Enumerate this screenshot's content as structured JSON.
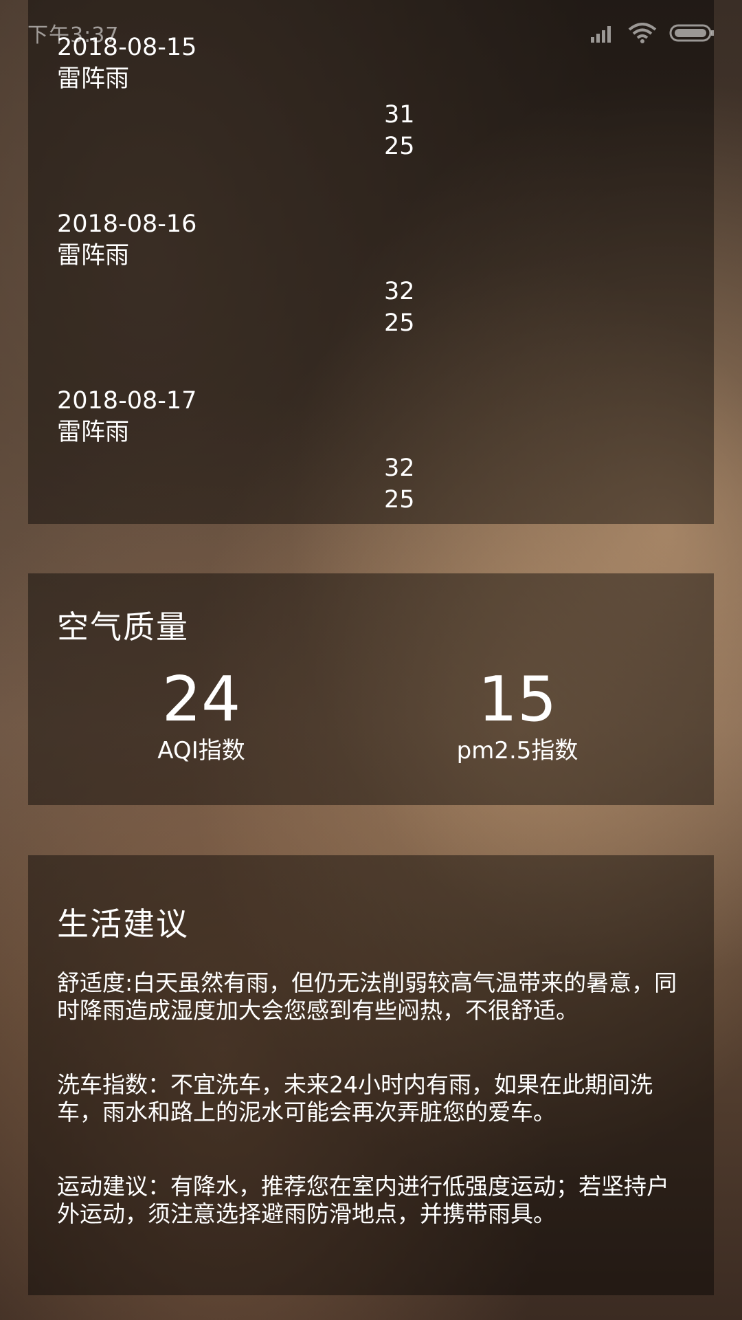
{
  "status_bar": {
    "time": "下午3:37",
    "icons": [
      "signal-icon",
      "wifi-icon",
      "battery-icon"
    ]
  },
  "forecast": [
    {
      "date": "2018-08-15",
      "info": "雷阵雨",
      "max": "31",
      "min": "25"
    },
    {
      "date": "2018-08-16",
      "info": "雷阵雨",
      "max": "32",
      "min": "25"
    },
    {
      "date": "2018-08-17",
      "info": "雷阵雨",
      "max": "32",
      "min": "25"
    }
  ],
  "aqi": {
    "title": "空气质量",
    "aqi_value": "24",
    "aqi_label": "AQI指数",
    "pm25_value": "15",
    "pm25_label": "pm2.5指数"
  },
  "suggestion": {
    "title": "生活建议",
    "comfort": "舒适度:白天虽然有雨，但仍无法削弱较高气温带来的暑意，同时降雨造成湿度加大会您感到有些闷热，不很舒适。",
    "car_wash": "洗车指数：不宜洗车，未来24小时内有雨，如果在此期间洗车，雨水和路上的泥水可能会再次弄脏您的爱车。",
    "sport": "运动建议：有降水，推荐您在室内进行低强度运动；若坚持户外运动，须注意选择避雨防滑地点，并携带雨具。"
  }
}
